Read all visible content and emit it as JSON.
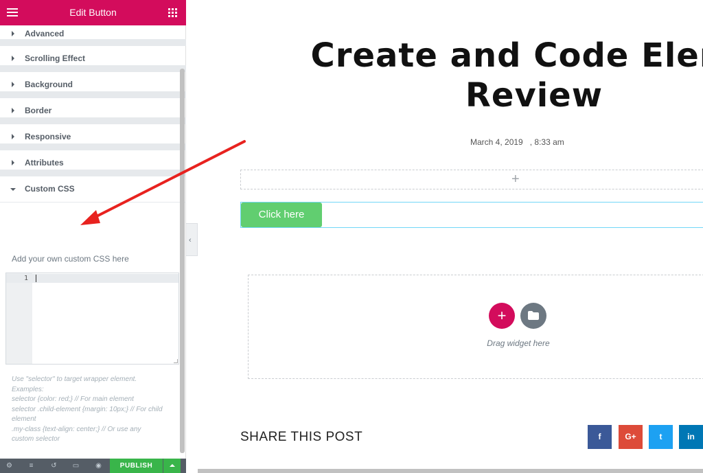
{
  "panel": {
    "title": "Edit Button",
    "sections": [
      {
        "label": "Advanced"
      },
      {
        "label": "Scrolling Effect"
      },
      {
        "label": "Background"
      },
      {
        "label": "Border"
      },
      {
        "label": "Responsive"
      },
      {
        "label": "Attributes"
      },
      {
        "label": "Custom CSS"
      }
    ],
    "custom_css": {
      "description": "Add your own custom CSS here",
      "line_number": "1",
      "help_lines": [
        "Use \"selector\" to target wrapper element.",
        "Examples:",
        "selector {color: red;} // For main element",
        "selector .child-element {margin: 10px;} // For child",
        "element",
        ".my-class {text-align: center;} // Or use any",
        "custom selector"
      ]
    },
    "footer": {
      "publish_label": "PUBLISH"
    }
  },
  "preview": {
    "title_line1": "Create and Code Eleme",
    "title_line2": "Review",
    "meta": "March 4, 2019   , 8:33 am",
    "add_section_glyph": "+",
    "button_text": "Click here",
    "add_widget_glyph": "+",
    "drag_text": "Drag widget here",
    "share_title": "SHARE THIS POST",
    "share_buttons": [
      {
        "label": "f",
        "color": "#3b5998"
      },
      {
        "label": "G+",
        "color": "#dd4b39"
      },
      {
        "label": "t",
        "color": "#1da1f2"
      },
      {
        "label": "in",
        "color": "#0077b5"
      }
    ]
  },
  "colors": {
    "brand": "#d30c5c",
    "publish": "#39b54a",
    "button": "#61ce70",
    "annotation_arrow": "#e8221f"
  }
}
